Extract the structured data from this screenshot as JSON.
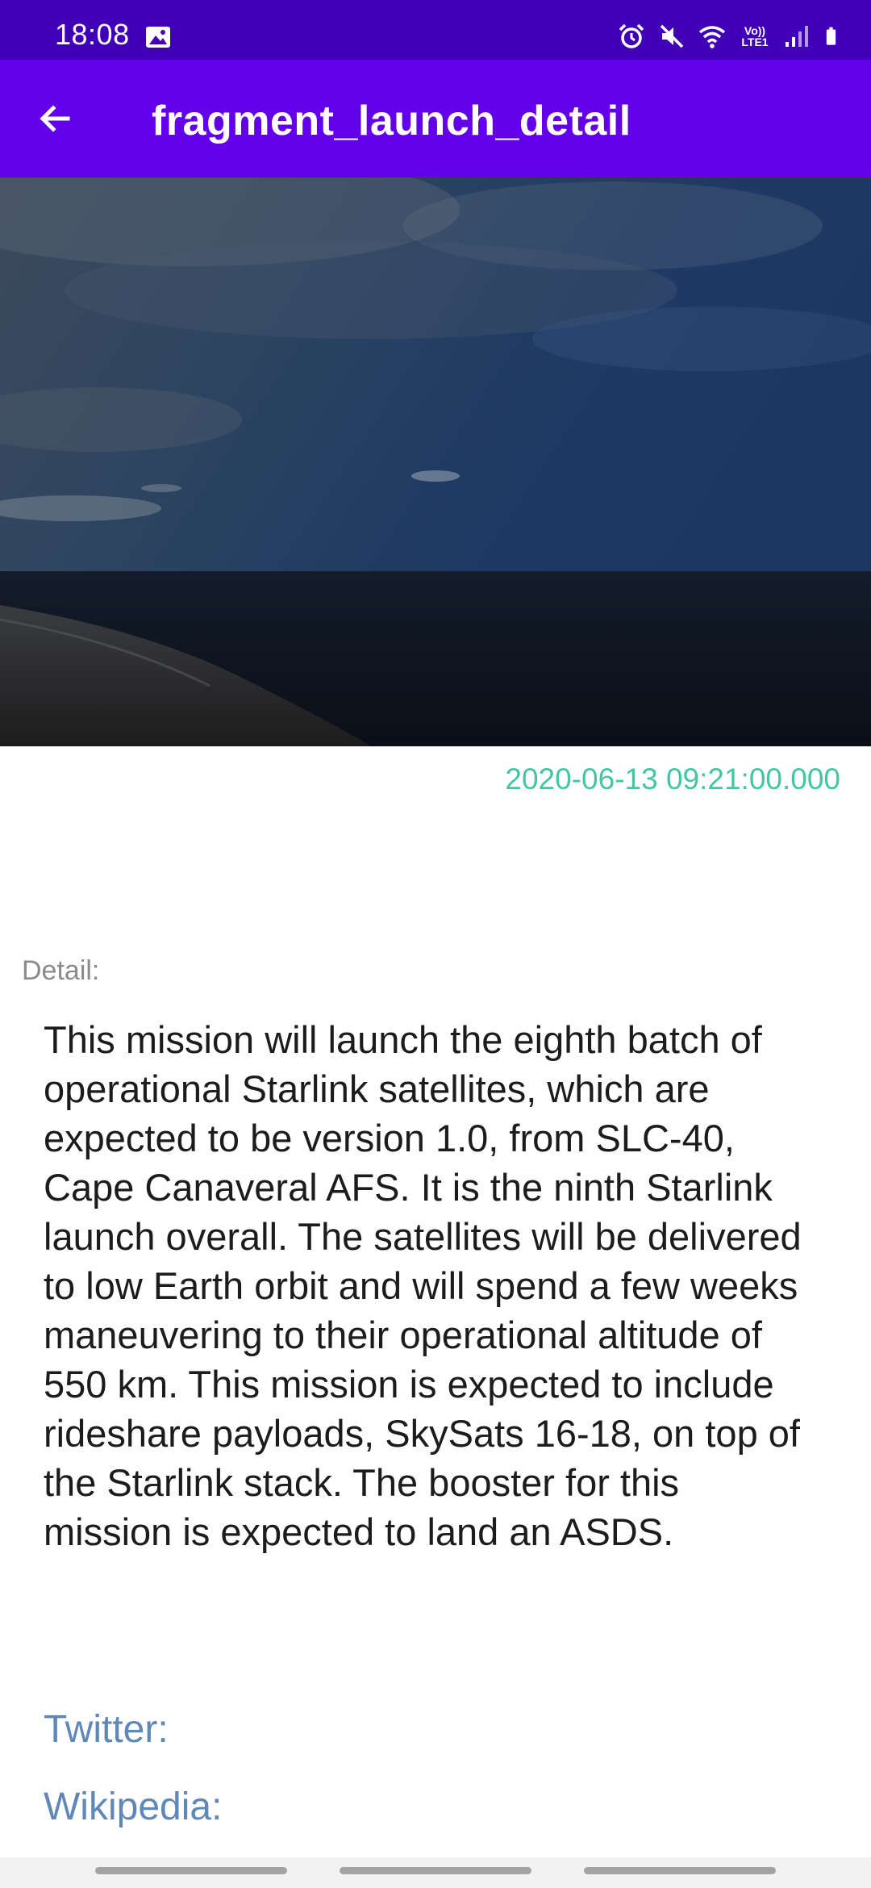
{
  "status_bar": {
    "time": "18:08",
    "network_label": "Vo)) LTE1",
    "icons": [
      "gallery-icon",
      "alarm-icon",
      "mute-icon",
      "wifi-icon",
      "signal-icon",
      "battery-icon"
    ]
  },
  "app_bar": {
    "title": "fragment_launch_detail",
    "back_icon": "arrow-left-icon",
    "background": "#6200ea"
  },
  "hero": {
    "image": "night-sky-beach-photo"
  },
  "launch": {
    "date": "2020-06-13 09:21:00.000",
    "detail_label": "Detail:",
    "description": "This mission will launch the eighth batch of operational Starlink satellites, which are expected to be version 1.0, from SLC-40, Cape Canaveral AFS. It is the ninth Starlink launch overall. The satellites will be delivered to low Earth orbit and will spend a few weeks maneuvering to their operational altitude of 550 km. This mission is expected to include rideshare payloads, SkySats 16-18, on top of the Starlink stack. The booster for this mission is expected to land an ASDS."
  },
  "links": {
    "twitter": "Twitter:",
    "wikipedia": "Wikipedia:"
  },
  "colors": {
    "status_bar": "#3f00b8",
    "date_text": "#44c6a2",
    "link_text": "#5f88b8"
  }
}
